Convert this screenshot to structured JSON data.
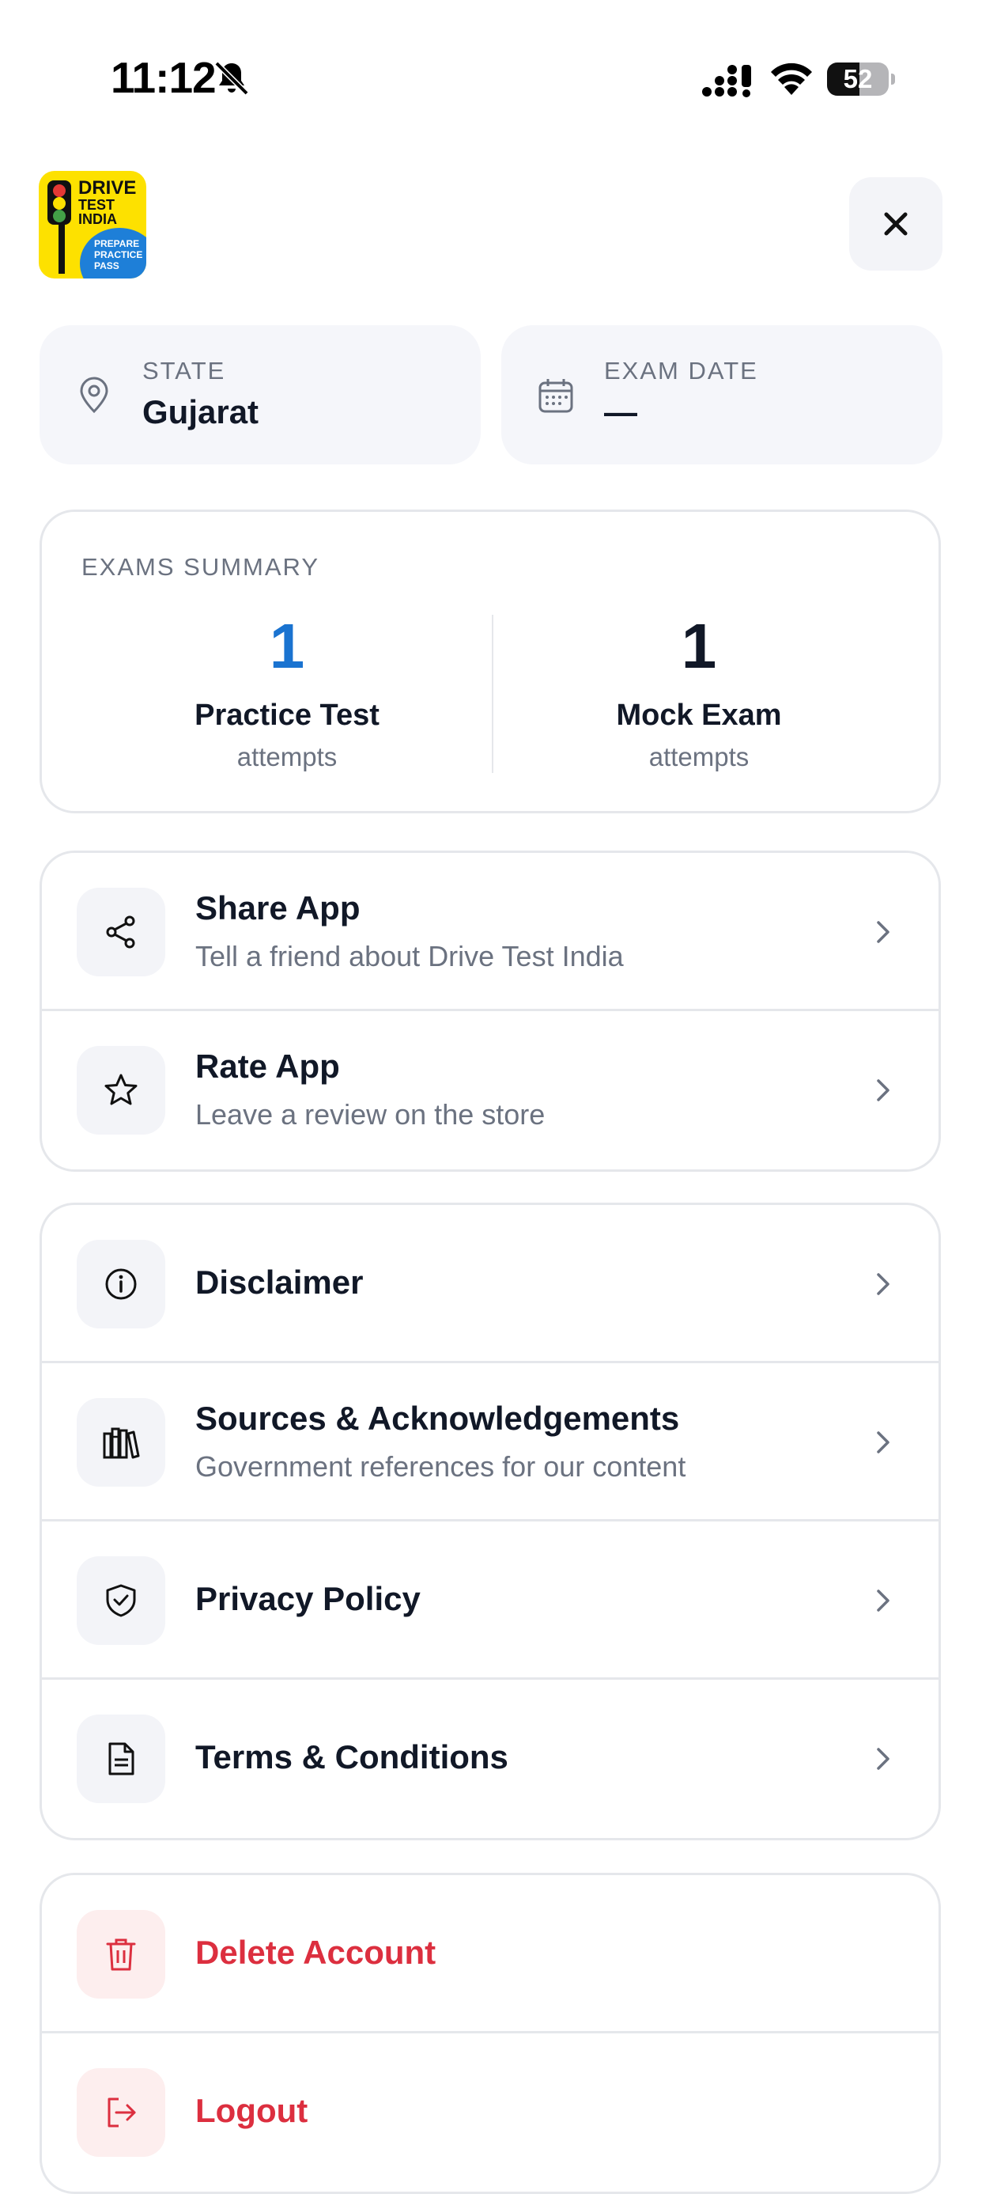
{
  "status_bar": {
    "time": "11:12",
    "battery": "52",
    "battery_level": 0.52
  },
  "app": {
    "logo_line1": "DRIVE",
    "logo_line2": "TEST",
    "logo_line3": "INDIA",
    "logo_badge": [
      "PREPARE",
      "PRACTICE",
      "PASS"
    ]
  },
  "info": {
    "state_label": "STATE",
    "state_value": "Gujarat",
    "exam_label": "EXAM DATE",
    "exam_value": "—"
  },
  "summary": {
    "title": "EXAMS SUMMARY",
    "practice": {
      "count": "1",
      "name": "Practice Test",
      "sub": "attempts"
    },
    "mock": {
      "count": "1",
      "name": "Mock Exam",
      "sub": "attempts"
    }
  },
  "menu": {
    "share": {
      "title": "Share App",
      "subtitle": "Tell a friend about Drive Test India"
    },
    "rate": {
      "title": "Rate App",
      "subtitle": "Leave a review on the store"
    },
    "disclaimer": {
      "title": "Disclaimer"
    },
    "sources": {
      "title": "Sources & Acknowledgements",
      "subtitle": "Government references for our content"
    },
    "privacy": {
      "title": "Privacy Policy"
    },
    "terms": {
      "title": "Terms & Conditions"
    },
    "delete": {
      "title": "Delete Account"
    },
    "logout": {
      "title": "Logout"
    }
  },
  "colors": {
    "accent_blue": "#1a73d0",
    "danger_red": "#dc2f3f",
    "card_bg": "#f5f6fa",
    "border": "#e5e7eb"
  }
}
